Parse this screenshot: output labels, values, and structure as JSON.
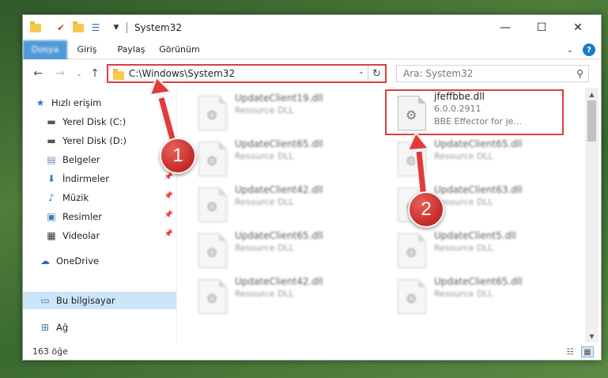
{
  "window": {
    "title": "System32"
  },
  "ribbon": {
    "tabs": [
      "Dosya",
      "Giriş",
      "Paylaş",
      "Görünüm"
    ]
  },
  "address": {
    "path": "C:\\Windows\\System32"
  },
  "search": {
    "placeholder": "Ara: System32"
  },
  "sidebar": {
    "items": [
      {
        "label": "Hızlı erişim"
      },
      {
        "label": "Yerel Disk (C:)"
      },
      {
        "label": "Yerel Disk (D:)"
      },
      {
        "label": "Belgeler"
      },
      {
        "label": "İndirmeler"
      },
      {
        "label": "Müzik"
      },
      {
        "label": "Resimler"
      },
      {
        "label": "Videolar"
      },
      {
        "label": "OneDrive"
      },
      {
        "label": "Bu bilgisayar"
      },
      {
        "label": "Ağ"
      }
    ]
  },
  "files": {
    "left": [
      {
        "name": "UpdateClient19.dll",
        "desc": "Resource DLL"
      },
      {
        "name": "UpdateClient65.dll",
        "desc": "Resource DLL"
      },
      {
        "name": "UpdateClient42.dll",
        "desc": "Resource DLL"
      },
      {
        "name": "UpdateClient65.dll",
        "desc": "Resource DLL"
      },
      {
        "name": "UpdateClient42.dll",
        "desc": "Resource DLL"
      }
    ],
    "highlighted": {
      "name": "jfeffbbe.dll",
      "version": "6.0.0.2911",
      "desc": "BBE Effector for je..."
    },
    "right": [
      {
        "name": "UpdateClient65.dll",
        "desc": "Resource DLL"
      },
      {
        "name": "UpdateClient63.dll",
        "desc": "Resource DLL"
      },
      {
        "name": "UpdateClient5.dll",
        "desc": "Resource DLL"
      },
      {
        "name": "UpdateClient65.dll",
        "desc": "Resource DLL"
      }
    ]
  },
  "status": {
    "count": "163 öğe"
  },
  "annotations": {
    "step1": "1",
    "step2": "2"
  },
  "colors": {
    "accent": "#1979ca",
    "highlight": "#e03c3c",
    "selection": "#cce4f7"
  }
}
